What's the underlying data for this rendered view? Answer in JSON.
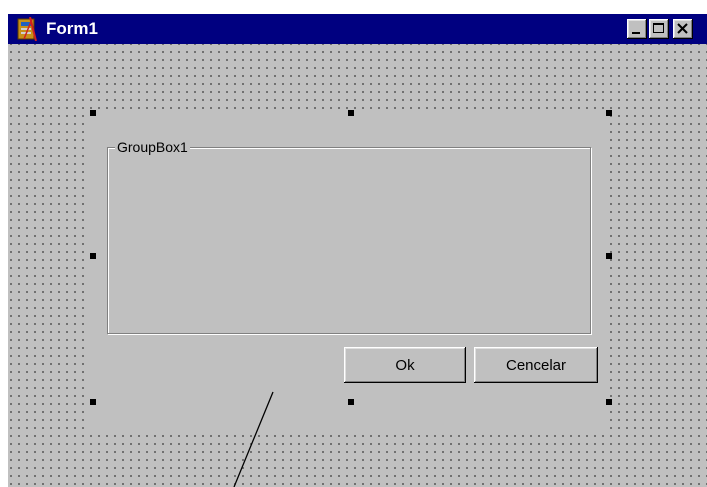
{
  "window": {
    "title": "Form1",
    "icon": "delphi-form-icon",
    "caption_buttons": [
      "minimize-icon",
      "maximize-icon",
      "close-icon"
    ]
  },
  "groupbox": {
    "caption": "GroupBox1"
  },
  "buttons": {
    "ok_label": "Ok",
    "cancel_label": "Cencelar"
  },
  "colors": {
    "titlebar": "#000080",
    "face": "#c0c0c0",
    "grid_dot": "#5c5c5c",
    "handle": "#000000"
  }
}
